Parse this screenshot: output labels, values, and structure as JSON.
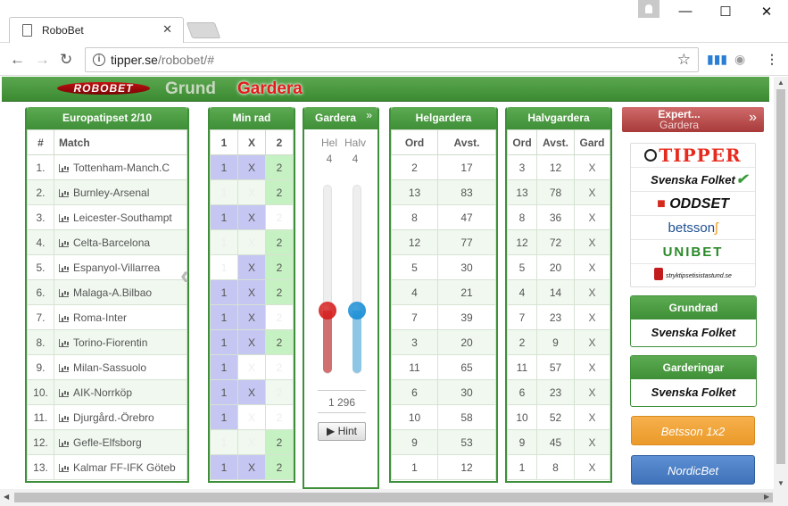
{
  "browser": {
    "tab_title": "RoboBet",
    "url_host": "tipper.se",
    "url_path": "/robobet/#"
  },
  "app": {
    "logo": "ROBOBET",
    "nav": [
      "Grund",
      "Gardera"
    ]
  },
  "coupon": {
    "title": "Europatipset 2/10",
    "col_num": "#",
    "col_match": "Match"
  },
  "minrad": {
    "title": "Min rad",
    "cols": [
      "1",
      "X",
      "2"
    ]
  },
  "gardera": {
    "title": "Gardera",
    "hel_label": "Hel",
    "halv_label": "Halv",
    "hel_value": "4",
    "halv_value": "4",
    "hel_level": 0.33,
    "halv_level": 0.33,
    "total": "1 296",
    "hint": "Hint"
  },
  "helgardera": {
    "title": "Helgardera",
    "cols": [
      "Ord",
      "Avst."
    ]
  },
  "halvgardera": {
    "title": "Halvgardera",
    "cols": [
      "Ord",
      "Avst.",
      "Gard"
    ]
  },
  "rows": [
    {
      "n": "1.",
      "match": "Tottenham-Manch.C",
      "p1": true,
      "px": true,
      "p2": true,
      "hel_ord": "2",
      "hel_avst": "17",
      "halv_ord": "3",
      "halv_avst": "12",
      "gard": "X"
    },
    {
      "n": "2.",
      "match": "Burnley-Arsenal",
      "p1": false,
      "px": false,
      "p2": true,
      "hel_ord": "13",
      "hel_avst": "83",
      "halv_ord": "13",
      "halv_avst": "78",
      "gard": "X"
    },
    {
      "n": "3.",
      "match": "Leicester-Southampt",
      "p1": true,
      "px": true,
      "p2": false,
      "hel_ord": "8",
      "hel_avst": "47",
      "halv_ord": "8",
      "halv_avst": "36",
      "gard": "X"
    },
    {
      "n": "4.",
      "match": "Celta-Barcelona",
      "p1": false,
      "px": false,
      "p2": true,
      "hel_ord": "12",
      "hel_avst": "77",
      "halv_ord": "12",
      "halv_avst": "72",
      "gard": "X"
    },
    {
      "n": "5.",
      "match": "Espanyol-Villarrea",
      "p1": false,
      "px": true,
      "p2": true,
      "hel_ord": "5",
      "hel_avst": "30",
      "halv_ord": "5",
      "halv_avst": "20",
      "gard": "X"
    },
    {
      "n": "6.",
      "match": "Malaga-A.Bilbao",
      "p1": true,
      "px": true,
      "p2": true,
      "hel_ord": "4",
      "hel_avst": "21",
      "halv_ord": "4",
      "halv_avst": "14",
      "gard": "X"
    },
    {
      "n": "7.",
      "match": "Roma-Inter",
      "p1": true,
      "px": true,
      "p2": false,
      "hel_ord": "7",
      "hel_avst": "39",
      "halv_ord": "7",
      "halv_avst": "23",
      "gard": "X"
    },
    {
      "n": "8.",
      "match": "Torino-Fiorentin",
      "p1": true,
      "px": true,
      "p2": true,
      "hel_ord": "3",
      "hel_avst": "20",
      "halv_ord": "2",
      "halv_avst": "9",
      "gard": "X"
    },
    {
      "n": "9.",
      "match": "Milan-Sassuolo",
      "p1": true,
      "px": false,
      "p2": false,
      "hel_ord": "11",
      "hel_avst": "65",
      "halv_ord": "11",
      "halv_avst": "57",
      "gard": "X"
    },
    {
      "n": "10.",
      "match": "AIK-Norrköp",
      "p1": true,
      "px": true,
      "p2": false,
      "hel_ord": "6",
      "hel_avst": "30",
      "halv_ord": "6",
      "halv_avst": "23",
      "gard": "X"
    },
    {
      "n": "11.",
      "match": "Djurgård.-Örebro",
      "p1": true,
      "px": false,
      "p2": false,
      "hel_ord": "10",
      "hel_avst": "58",
      "halv_ord": "10",
      "halv_avst": "52",
      "gard": "X"
    },
    {
      "n": "12.",
      "match": "Gefle-Elfsborg",
      "p1": false,
      "px": false,
      "p2": true,
      "hel_ord": "9",
      "hel_avst": "53",
      "halv_ord": "9",
      "halv_avst": "45",
      "gard": "X"
    },
    {
      "n": "13.",
      "match": "Kalmar FF-IFK Göteb",
      "p1": true,
      "px": true,
      "p2": true,
      "hel_ord": "1",
      "hel_avst": "12",
      "halv_ord": "1",
      "halv_avst": "8",
      "gard": "X"
    }
  ],
  "expert": {
    "line1": "Expert...",
    "line2": "Gardera"
  },
  "brands": [
    "TIPPER",
    "Svenska Folket",
    "ODDSET",
    "betsson",
    "UNIBET",
    "stryktipsetisistastund.se"
  ],
  "grundrad": {
    "title": "Grundrad",
    "source": "Svenska Folket"
  },
  "garderingar": {
    "title": "Garderingar",
    "source": "Svenska Folket"
  },
  "buttons": {
    "betsson": "Betsson 1x2",
    "nordicbet": "NordicBet"
  },
  "colors": {
    "green": "#3f8f3a",
    "pick_1x": "#c5c6f1",
    "pick_2": "#c6f1c3",
    "hel_slider": "#d62020",
    "halv_slider": "#1b8fd6"
  }
}
